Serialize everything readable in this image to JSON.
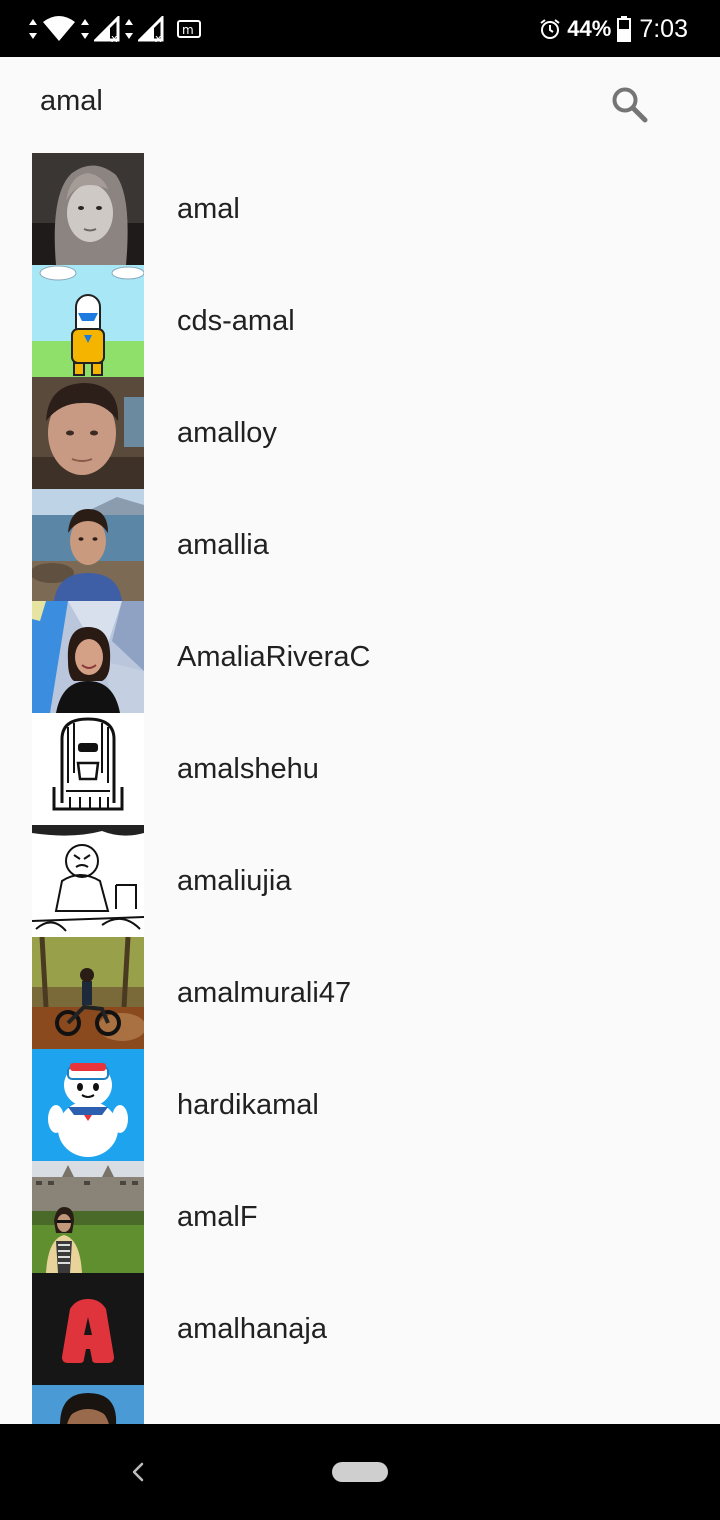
{
  "status_bar": {
    "battery_percent": "44%",
    "time": "7:03",
    "icons": [
      "wifi-icon",
      "signal-icon",
      "signal-icon",
      "notification-icon",
      "alarm-icon",
      "battery-icon"
    ]
  },
  "search": {
    "query": "amal",
    "icon": "search-icon"
  },
  "results": [
    {
      "username": "amal",
      "avatar": "portrait-photo-bw"
    },
    {
      "username": "cds-amal",
      "avatar": "cartoon-robot"
    },
    {
      "username": "amalloy",
      "avatar": "portrait-photo"
    },
    {
      "username": "amallia",
      "avatar": "portrait-photo-seaside"
    },
    {
      "username": "AmaliaRiveraC",
      "avatar": "portrait-photo-geometric"
    },
    {
      "username": "amalshehu",
      "avatar": "line-art-pharaoh"
    },
    {
      "username": "amaliujia",
      "avatar": "sketch-drawing"
    },
    {
      "username": "amalmurali47",
      "avatar": "motorbike-photo"
    },
    {
      "username": "hardikamal",
      "avatar": "marshmallow-toy"
    },
    {
      "username": "amalF",
      "avatar": "campus-photo"
    },
    {
      "username": "amalhanaja",
      "avatar": "letter-a-logo"
    },
    {
      "username": "",
      "avatar": "portrait-photo-partial"
    }
  ],
  "nav_bar": {
    "icons": [
      "back-icon",
      "home-pill-icon"
    ]
  },
  "colors": {
    "background": "#fafafa",
    "text": "#212121",
    "status_bar": "#000000",
    "search_icon": "#757575"
  }
}
